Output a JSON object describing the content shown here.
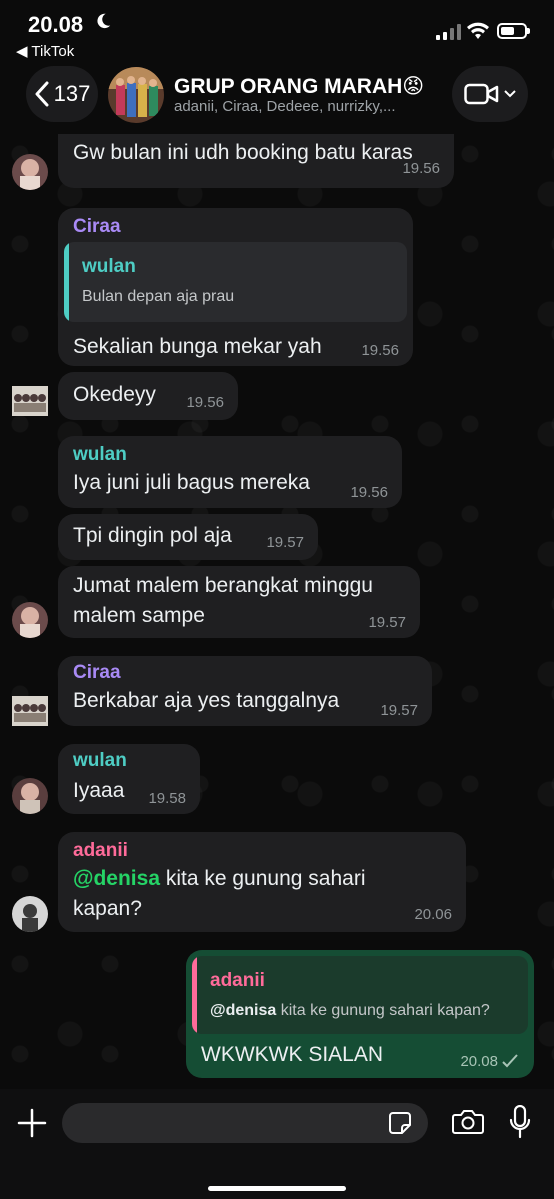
{
  "status_bar": {
    "time": "20.08",
    "back_app": "◀ TikTok"
  },
  "header": {
    "back_count": "137",
    "group_name": "GRUP ORANG MARAH😡",
    "members": "adanii, Ciraa, Dedeee, nurrizky,..."
  },
  "colors": {
    "accent_green": "#25d366",
    "outgoing_bubble": "#154d34",
    "incoming_bubble": "#1f1f21",
    "ciraa": "#a98af5",
    "wulan": "#4ecdc4",
    "adanii": "#ff6b9a"
  },
  "messages": [
    {
      "text": "Gw bulan ini udh booking batu karas",
      "time": "19.56"
    },
    {
      "sender": "Ciraa",
      "quote_name": "wulan",
      "quote_text": "Bulan depan aja prau",
      "text": "Sekalian bunga mekar yah",
      "time": "19.56"
    },
    {
      "text": "Okedeyy",
      "time": "19.56"
    },
    {
      "sender": "wulan",
      "text": "Iya juni juli bagus mereka",
      "time": "19.56"
    },
    {
      "text": "Tpi dingin pol aja",
      "time": "19.57"
    },
    {
      "text_line1": "Jumat malem berangkat minggu",
      "text_line2": "malem sampe",
      "time": "19.57"
    },
    {
      "sender": "Ciraa",
      "text": "Berkabar aja yes tanggalnya",
      "time": "19.57"
    },
    {
      "sender": "wulan",
      "text": "Iyaaa",
      "time": "19.58"
    },
    {
      "sender": "adanii",
      "mention": "@denisa",
      "text_line1_rest": " kita ke gunung sahari",
      "text_line2": "kapan?",
      "time": "20.06"
    },
    {
      "quote_name": "adanii",
      "quote_mention": "@denisa",
      "quote_rest": " kita ke gunung sahari kapan?",
      "text": "WKWKWK SIALAN",
      "time": "20.08",
      "outgoing": true
    }
  ],
  "icons": [
    "moon-icon",
    "signal-icon",
    "wifi-icon",
    "battery-icon",
    "chevron-left-icon",
    "video-call-icon",
    "chevron-down-icon",
    "plus-icon",
    "sticker-icon",
    "camera-icon",
    "microphone-icon",
    "read-check-icon"
  ]
}
